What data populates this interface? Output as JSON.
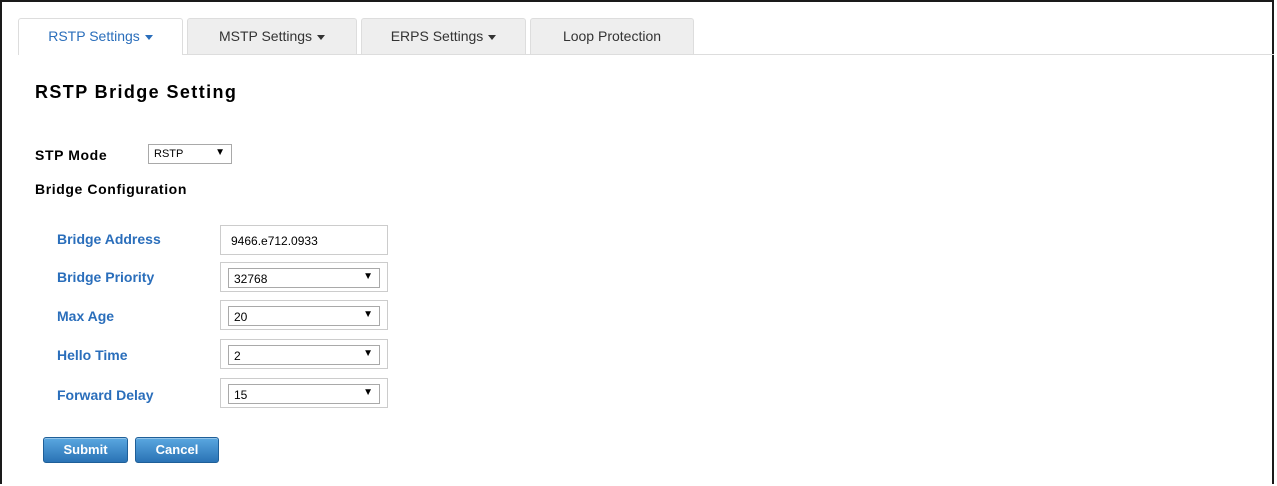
{
  "tabs": [
    {
      "label": "RSTP Settings",
      "has_caret": true,
      "active": true
    },
    {
      "label": "MSTP Settings",
      "has_caret": true,
      "active": false
    },
    {
      "label": "ERPS Settings",
      "has_caret": true,
      "active": false
    },
    {
      "label": "Loop Protection",
      "has_caret": false,
      "active": false
    }
  ],
  "page_title": "RSTP Bridge Setting",
  "stp_mode": {
    "label": "STP Mode",
    "value": "RSTP"
  },
  "section_title": "Bridge Configuration",
  "fields": {
    "bridge_address": {
      "label": "Bridge Address",
      "value": "9466.e712.0933"
    },
    "bridge_priority": {
      "label": "Bridge Priority",
      "value": "32768"
    },
    "max_age": {
      "label": "Max Age",
      "value": "20"
    },
    "hello_time": {
      "label": "Hello Time",
      "value": "2"
    },
    "forward_delay": {
      "label": "Forward Delay",
      "value": "15"
    }
  },
  "buttons": {
    "submit": "Submit",
    "cancel": "Cancel"
  },
  "icons": {
    "dropdown_arrow": "▼"
  },
  "colors": {
    "accent": "#2a6ebb",
    "button": "#2f7fc4"
  }
}
